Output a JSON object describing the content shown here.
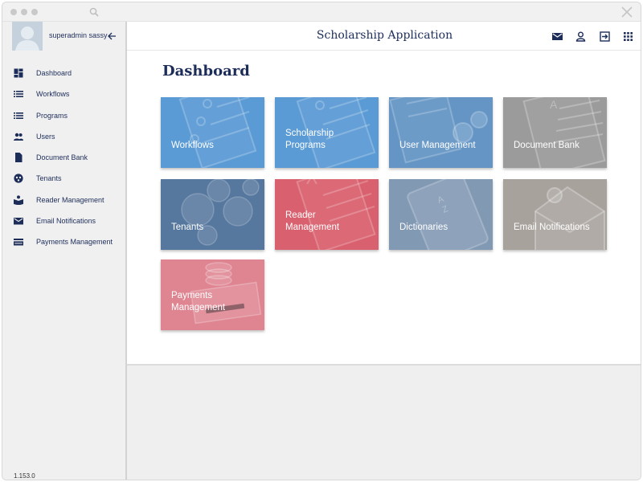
{
  "app": {
    "title": "Scholarship Application",
    "version": "1.153.0"
  },
  "user": {
    "name": "superadmin sassy"
  },
  "sidebar": {
    "items": [
      {
        "label": "Dashboard",
        "icon": "dashboard-icon"
      },
      {
        "label": "Workflows",
        "icon": "list-icon"
      },
      {
        "label": "Programs",
        "icon": "list-icon"
      },
      {
        "label": "Users",
        "icon": "people-icon"
      },
      {
        "label": "Document Bank",
        "icon": "document-icon"
      },
      {
        "label": "Tenants",
        "icon": "tenants-icon"
      },
      {
        "label": "Reader Management",
        "icon": "reader-icon"
      },
      {
        "label": "Email Notifications",
        "icon": "mail-icon"
      },
      {
        "label": "Payments Management",
        "icon": "payment-card-icon"
      }
    ]
  },
  "header": {
    "icons": [
      "mail-icon",
      "user-icon",
      "logout-icon",
      "apps-grid-icon"
    ]
  },
  "main": {
    "page_title": "Dashboard",
    "tiles": [
      {
        "label": "Workflows",
        "color": "#5b9bd5"
      },
      {
        "label": "Scholarship\nPrograms",
        "color": "#5b9bd5"
      },
      {
        "label": "User Management",
        "color": "#6495c5"
      },
      {
        "label": "Document Bank",
        "color": "#9b9b9b"
      },
      {
        "label": "Tenants",
        "color": "#56779e"
      },
      {
        "label": "Reader\nManagement",
        "color": "#d9606e"
      },
      {
        "label": "Dictionaries",
        "color": "#8299b4"
      },
      {
        "label": "Email Notifications",
        "color": "#a8a29d"
      },
      {
        "label": "Payments\nManagement",
        "color": "#df8591"
      }
    ]
  },
  "colors": {
    "brand_navy": "#1d2d5a",
    "sidebar_bg": "#f0f0f0"
  }
}
